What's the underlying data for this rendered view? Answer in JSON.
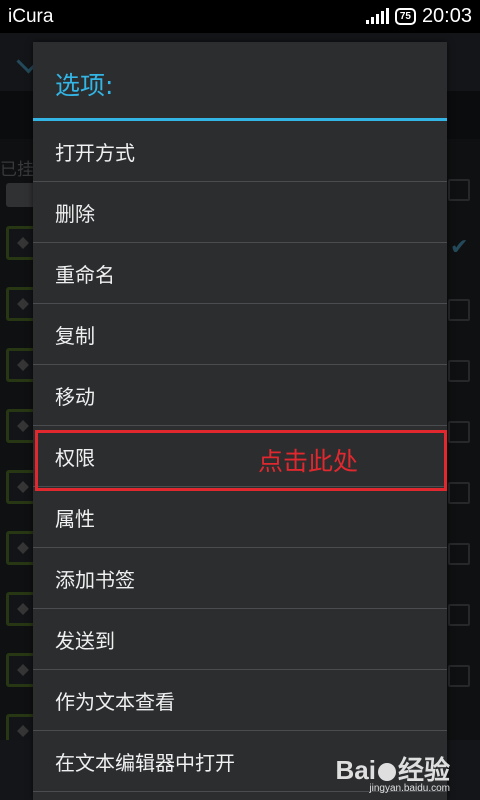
{
  "status_bar": {
    "app_name": "iCura",
    "battery": "75",
    "time": "20:03"
  },
  "background": {
    "partial_label": "已挂"
  },
  "dialog": {
    "title": "选项:",
    "items": [
      {
        "label": "打开方式"
      },
      {
        "label": "删除"
      },
      {
        "label": "重命名"
      },
      {
        "label": "复制"
      },
      {
        "label": "移动"
      },
      {
        "label": "权限"
      },
      {
        "label": "属性"
      },
      {
        "label": "添加书签"
      },
      {
        "label": "发送到"
      },
      {
        "label": "作为文本查看"
      },
      {
        "label": "在文本编辑器中打开"
      }
    ]
  },
  "annotation": {
    "text": "点击此处",
    "color": "#e0282e"
  },
  "watermark": {
    "brand": "Bai",
    "brand_suffix": "经验",
    "url": "jingyan.baidu.com"
  },
  "colors": {
    "accent": "#33b5e5",
    "dialog_bg": "#2b2d2f"
  }
}
